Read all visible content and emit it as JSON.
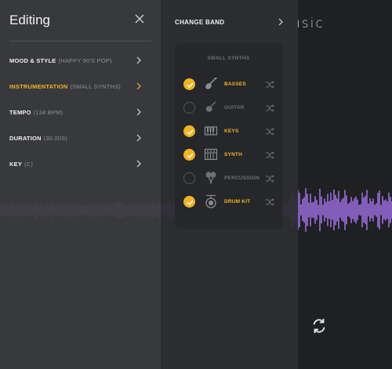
{
  "background": {
    "title_fragment": "usic",
    "accent_color": "#9b6ee0"
  },
  "editing": {
    "title": "Editing",
    "items": [
      {
        "label": "MOOD & STYLE",
        "value": "(HAPPY 90'S POP)",
        "active": false
      },
      {
        "label": "INSTRUMENTATION",
        "value": "(SMALL SYNTHS)",
        "active": true
      },
      {
        "label": "TEMPO",
        "value": "(134 BPM)",
        "active": false
      },
      {
        "label": "DURATION",
        "value": "(30.00S)",
        "active": false
      },
      {
        "label": "KEY",
        "value": "(C)",
        "active": false
      }
    ]
  },
  "band": {
    "header": "CHANGE BAND",
    "card_title": "SMALL SYNTHS",
    "instruments": [
      {
        "label": "BASSES",
        "selected": true,
        "icon": "bass-guitar-icon"
      },
      {
        "label": "GUITAR",
        "selected": false,
        "icon": "guitar-icon"
      },
      {
        "label": "KEYS",
        "selected": true,
        "icon": "keys-icon"
      },
      {
        "label": "SYNTH",
        "selected": true,
        "icon": "synth-icon"
      },
      {
        "label": "PERCUSSION",
        "selected": false,
        "icon": "maracas-icon"
      },
      {
        "label": "DRUM KIT",
        "selected": true,
        "icon": "drum-icon"
      }
    ]
  },
  "colors": {
    "accent": "#f0b323",
    "wave": "#9b6ee0"
  }
}
